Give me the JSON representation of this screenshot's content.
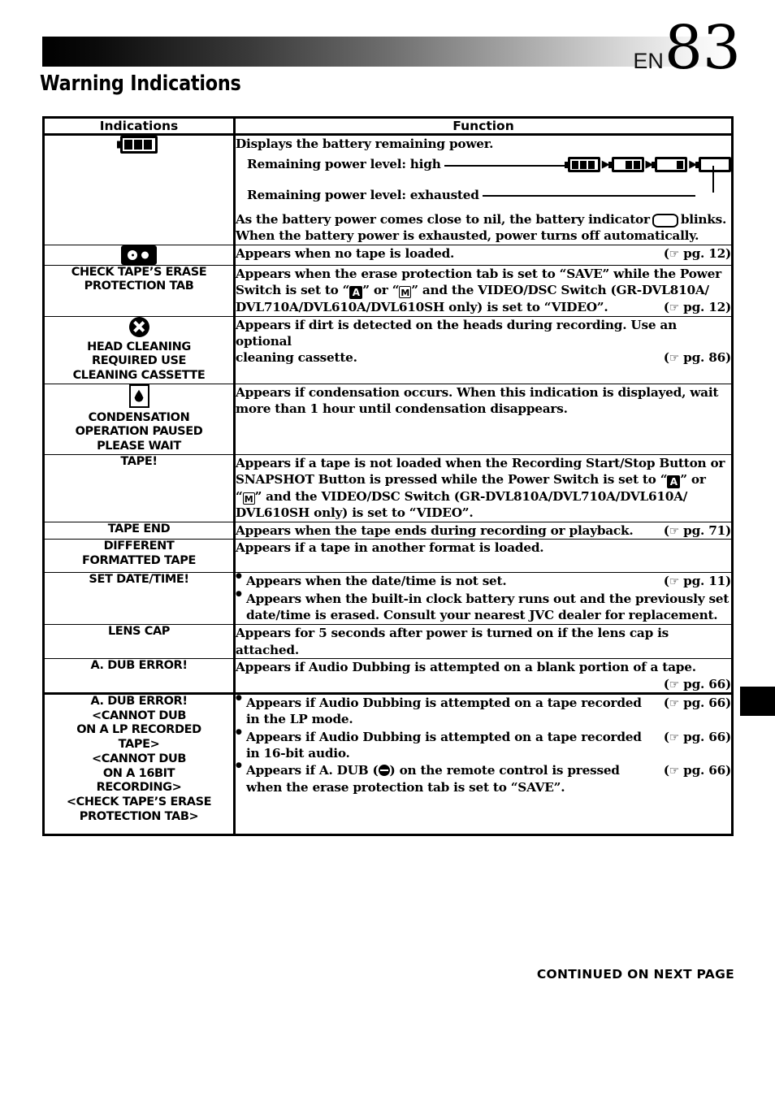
{
  "page": {
    "locale_label": "EN",
    "page_number": "83",
    "title": "Warning Indications",
    "footer": "CONTINUED ON NEXT PAGE"
  },
  "table": {
    "headers": {
      "col1": "Indications",
      "col2": "Function"
    },
    "rows": [
      {
        "id": "battery-indicator",
        "indication_icon": "battery-full-icon",
        "indication_text": "",
        "function": {
          "intro": "Displays the battery remaining power.",
          "level_high_label": "Remaining power level: high",
          "level_exhausted_label": "Remaining power level: exhausted",
          "battery_chain": [
            "battery-3-bars",
            "battery-2-bars",
            "battery-1-bar",
            "battery-0-bars"
          ],
          "note_part1": "As the battery power comes close to nil, the battery indicator",
          "note_part2": "blinks.",
          "note_line2": "When the battery power is exhausted, power turns off automatically."
        }
      },
      {
        "id": "no-tape",
        "indication_icon": "tape-cassette-icon",
        "indication_text": "",
        "function_text": "Appears when no tape is loaded.",
        "page_ref": "pg. 12"
      },
      {
        "id": "check-erase-protection-tab",
        "indication_icon": "",
        "indication_text": "CHECK TAPE’S ERASE\nPROTECTION TAB",
        "function_text_1": "Appears when the erase protection tab is set to “SAVE” while the Power",
        "function_text_2a": "Switch is set to “",
        "switch_auto": "A",
        "function_text_2b": "” or “",
        "switch_manual": "M",
        "function_text_2c": "” and the VIDEO/DSC Switch (GR-DVL810A/",
        "function_text_3": "DVL710A/DVL610A/DVL610SH only) is set to “VIDEO”.",
        "page_ref": "pg. 12"
      },
      {
        "id": "head-cleaning",
        "indication_icon": "x-in-circle-icon",
        "indication_text": "HEAD CLEANING\nREQUIRED USE\nCLEANING CASSETTE",
        "function_text_1": "Appears if dirt is detected on the heads during recording. Use an optional",
        "function_text_2": "cleaning cassette.",
        "page_ref": "pg. 86"
      },
      {
        "id": "condensation",
        "indication_icon": "condensation-droplet-icon",
        "indication_text": "CONDENSATION\nOPERATION PAUSED\nPLEASE WAIT",
        "function_text_1": "Appears if condensation occurs. When this indication is displayed, wait",
        "function_text_2": "more than 1 hour until condensation disappears."
      },
      {
        "id": "tape",
        "indication_icon": "",
        "indication_text": "TAPE!",
        "function_text_1": "Appears if a tape is not loaded when the Recording Start/Stop Button or",
        "function_text_2a": "SNAPSHOT Button is pressed while the Power Switch is set to “",
        "switch_auto": "A",
        "function_text_2b": "” or",
        "function_text_3a": "“",
        "switch_manual": "M",
        "function_text_3b": "” and the VIDEO/DSC Switch (GR-DVL810A/DVL710A/DVL610A/",
        "function_text_4": "DVL610SH only) is set to “VIDEO”."
      },
      {
        "id": "tape-end",
        "indication_icon": "",
        "indication_text": "TAPE END",
        "function_text": "Appears when the tape ends during recording or playback.",
        "page_ref": "pg. 71"
      },
      {
        "id": "different-formatted-tape",
        "indication_icon": "",
        "indication_text": "DIFFERENT\nFORMATTED TAPE",
        "function_text": "Appears if a tape in another format is loaded."
      },
      {
        "id": "set-date-time",
        "indication_icon": "",
        "indication_text": "SET DATE/TIME!",
        "bullets": [
          {
            "text": "Appears when the date/time is not set.",
            "page_ref": "pg. 11"
          },
          {
            "text": "Appears when the built-in clock battery runs out and the previously set date/time is erased. Consult your nearest JVC dealer for replacement.",
            "page_ref": ""
          }
        ]
      },
      {
        "id": "lens-cap",
        "indication_icon": "",
        "indication_text": "LENS CAP",
        "function_text": "Appears for 5 seconds after power is turned on if the lens cap is attached."
      },
      {
        "id": "a-dub-error",
        "indication_icon": "",
        "indication_text": "A. DUB ERROR!",
        "function_text": "Appears if Audio Dubbing is attempted on a blank portion of a tape.",
        "page_ref": "pg. 66"
      },
      {
        "id": "a-dub-error-detail",
        "indication_icon": "",
        "indication_text": "A. DUB ERROR!\n<CANNOT DUB\nON A LP RECORDED\nTAPE>\n<CANNOT DUB\nON A 16BIT\nRECORDING>\n<CHECK TAPE’S ERASE\nPROTECTION TAB>",
        "bullets": [
          {
            "text": "Appears if Audio Dubbing is attempted on a tape recorded in the LP mode.",
            "page_ref": "pg. 66"
          },
          {
            "text": "Appears if Audio Dubbing is attempted on a tape recorded in 16-bit audio.",
            "page_ref": "pg. 66"
          },
          {
            "text_a": "Appears if A. DUB (",
            "icon": "a-dub-remote-icon",
            "text_b": ") on the remote control is pressed when the erase protection tab is set to “SAVE”.",
            "page_ref": "pg. 66"
          }
        ]
      }
    ]
  }
}
